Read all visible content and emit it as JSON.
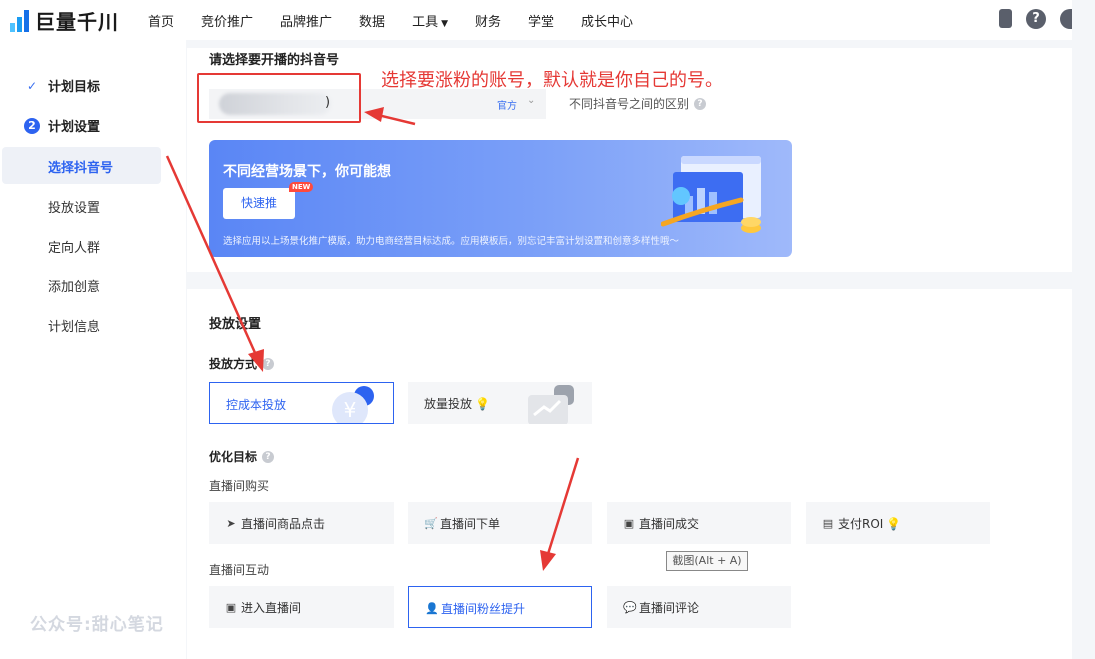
{
  "app": {
    "logo_text": "巨量千川"
  },
  "nav": {
    "items": [
      "首页",
      "竞价推广",
      "品牌推广",
      "数据",
      "工具",
      "财务",
      "学堂",
      "成长中心"
    ]
  },
  "sidebar": {
    "step1": "计划目标",
    "step2_num": "2",
    "step2": "计划设置",
    "subs": [
      "选择抖音号",
      "投放设置",
      "定向人群",
      "添加创意",
      "计划信息"
    ],
    "watermark": "公众号:甜心笔记"
  },
  "account": {
    "title": "请选择要开播的抖音号",
    "paren": ")",
    "official": "官方",
    "diff_link": "不同抖音号之间的区别"
  },
  "banner": {
    "title": "不同经营场景下，你可能想",
    "button": "快速推",
    "new_badge": "NEW",
    "desc": "选择应用以上场景化推广模版，助力电商经营目标达成。应用模板后，别忘记丰富计划设置和创意多样性哦～"
  },
  "delivery": {
    "title": "投放设置",
    "method_label": "投放方式",
    "methods": [
      "控成本投放",
      "放量投放"
    ],
    "goal_label": "优化目标",
    "group1_label": "直播间购买",
    "group1": [
      "直播间商品点击",
      "直播间下单",
      "直播间成交",
      "支付ROI"
    ],
    "group2_label": "直播间互动",
    "group2": [
      "进入直播间",
      "直播间粉丝提升",
      "直播间评论"
    ]
  },
  "tooltip": "截图(Alt + A)",
  "annotation": "选择要涨粉的账号，默认就是你自己的号。",
  "colors": {
    "accent": "#2d63f0",
    "annotation_red": "#e53935"
  }
}
